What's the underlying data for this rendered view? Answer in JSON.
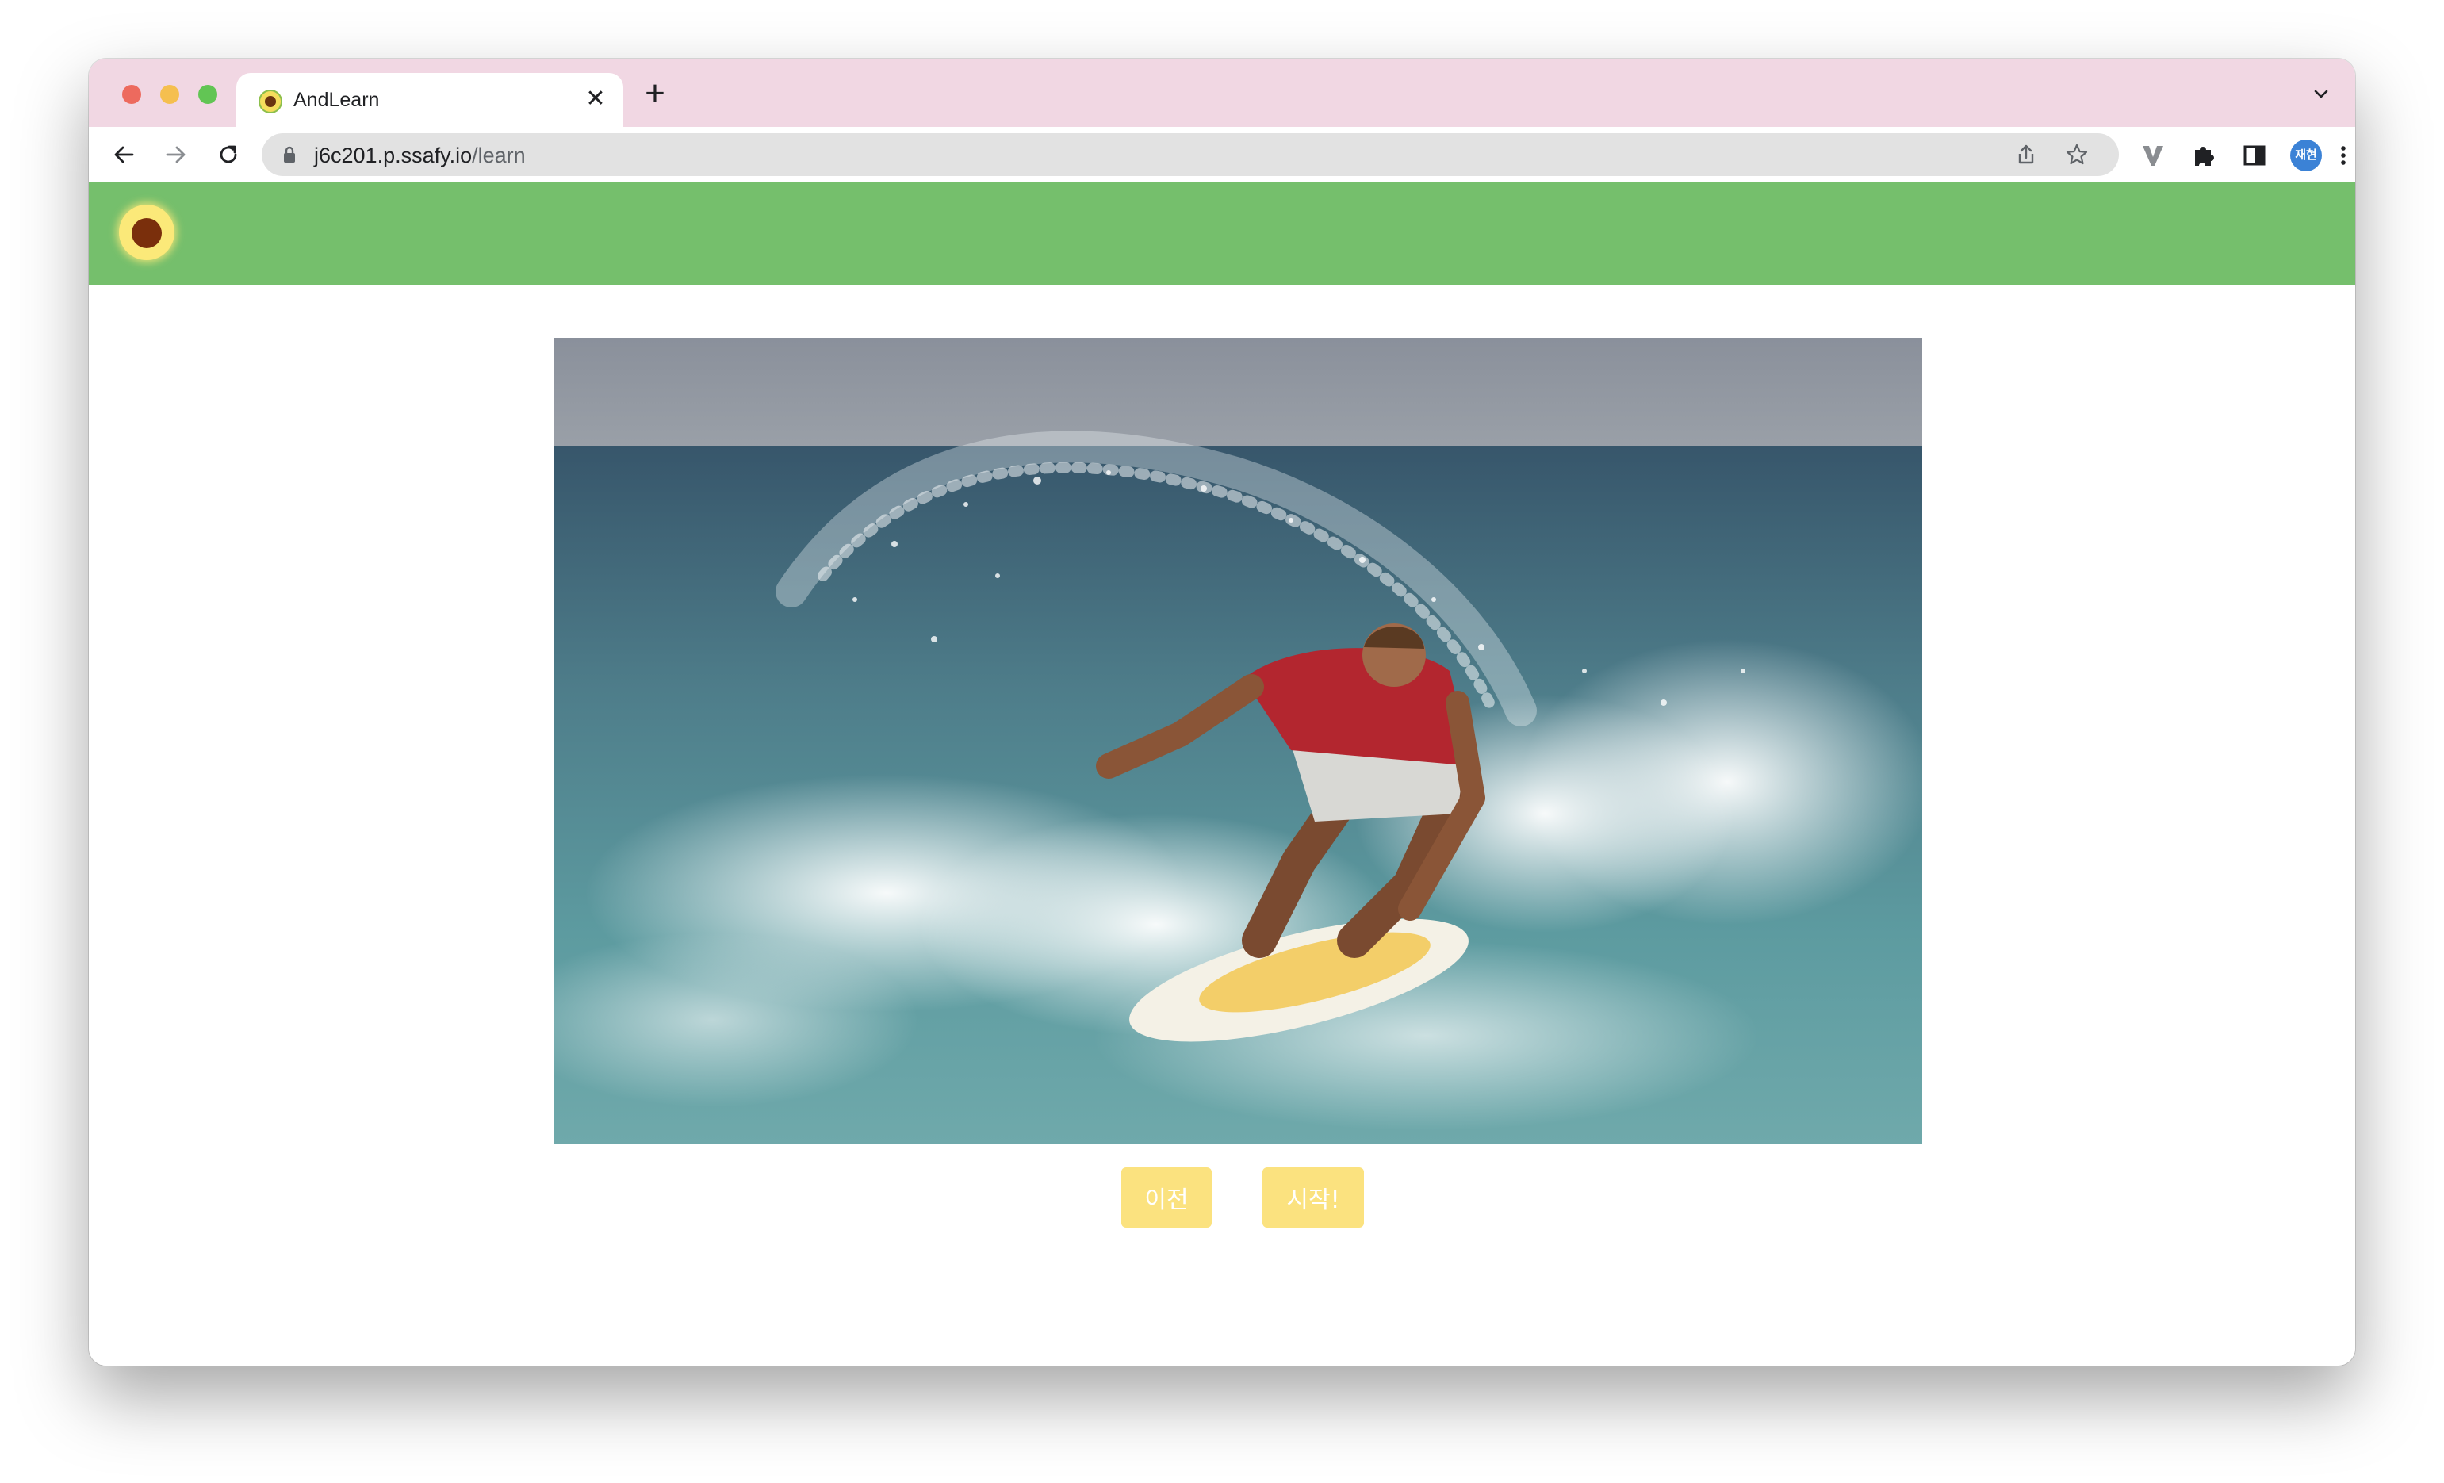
{
  "browser": {
    "tab_title": "AndLearn",
    "tab_close": "✕",
    "new_tab": "+",
    "url_host": "j6c201.p.ssafy.io",
    "url_path": "/learn",
    "profile_initials": "재현"
  },
  "page": {
    "header_color": "#75bf6c",
    "photo_subject": "surfer riding a wave on a yellow and white surfboard",
    "buttons": {
      "prev_label": "이전",
      "start_label": "시작!"
    }
  },
  "icons": {
    "back": "arrow-left-icon",
    "forward": "arrow-right-icon",
    "reload": "reload-icon",
    "lock": "lock-icon",
    "share": "share-icon",
    "bookmark": "star-icon",
    "extension_v": "v-extension-icon",
    "extensions": "puzzle-icon",
    "side_panel": "side-panel-icon",
    "menu": "kebab-menu-icon",
    "tab_search": "chevron-down-icon"
  }
}
